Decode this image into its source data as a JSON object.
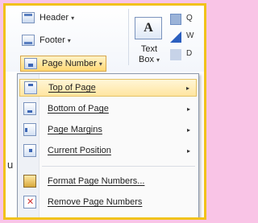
{
  "ribbon": {
    "header_label": "Header",
    "footer_label": "Footer",
    "page_number_label": "Page Number",
    "textbox_glyph": "A",
    "textbox_label_line1": "Text",
    "textbox_label_line2": "Box",
    "right_partial_1": "Q",
    "right_partial_2": "W",
    "right_partial_3": "D"
  },
  "menu": {
    "items": [
      {
        "label": "Top of Page",
        "icon": "top-of-page-icon",
        "submenu": true
      },
      {
        "label": "Bottom of Page",
        "icon": "bottom-of-page-icon",
        "submenu": true
      },
      {
        "label": "Page Margins",
        "icon": "page-margins-icon",
        "submenu": true
      },
      {
        "label": "Current Position",
        "icon": "current-position-icon",
        "submenu": true
      },
      {
        "label": "Format Page Numbers...",
        "icon": "format-page-numbers-icon",
        "submenu": false
      },
      {
        "label": "Remove Page Numbers",
        "icon": "remove-page-numbers-icon",
        "submenu": false
      }
    ],
    "submenu_arrow": "▸",
    "highlight_color": "#ffe5a0"
  },
  "background": {
    "page_color": "#f9c4e6",
    "frame_color": "#f1c21b"
  },
  "partial_left_text": "u"
}
